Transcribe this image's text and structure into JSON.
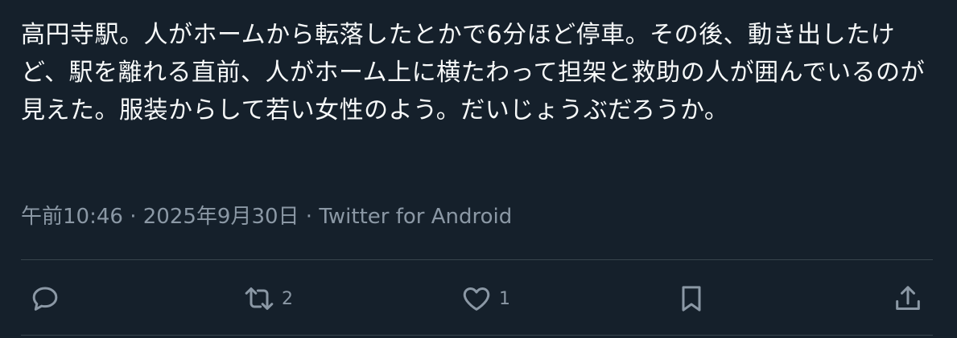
{
  "tweet": {
    "text": "高円寺駅。人がホームから転落したとかで6分ほど停車。その後、動き出したけど、駅を離れる直前、人がホーム上に横たわって担架と救助の人が囲んでいるのが見えた。服装からして若い女性のよう。だいじょうぶだろうか。",
    "time": "午前10:46",
    "separator": "·",
    "date": "2025年9月30日",
    "client": "Twitter for Android"
  },
  "actions": {
    "reply": {
      "icon": "reply-icon",
      "count": ""
    },
    "retweet": {
      "icon": "retweet-icon",
      "count": "2"
    },
    "like": {
      "icon": "heart-icon",
      "count": "1"
    },
    "bookmark": {
      "icon": "bookmark-icon"
    },
    "share": {
      "icon": "share-icon"
    }
  },
  "colors": {
    "background": "#15202b",
    "text": "#f7f9f9",
    "muted": "#8b98a5",
    "divider": "#38444d"
  }
}
